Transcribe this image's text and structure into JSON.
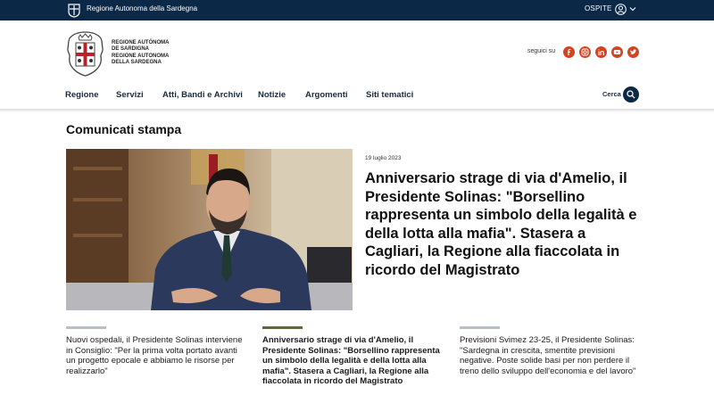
{
  "topbar": {
    "region_link": "Regione Autonoma della Sardegna",
    "user_label": "OSPITE",
    "background": "#0b2847"
  },
  "header": {
    "logo_lines": [
      "REGIONE AUTÒNOMA",
      "DE SARDIGNA",
      "REGIONE AUTONOMA",
      "DELLA SARDEGNA"
    ],
    "follow_label": "seguici su",
    "social_icons": [
      "facebook-icon",
      "instagram-icon",
      "linkedin-icon",
      "youtube-icon",
      "twitter-icon"
    ],
    "accent": "#d1451f"
  },
  "nav": {
    "items": [
      "Regione",
      "Servizi",
      "Atti, Bandi e Archivi",
      "Notizie",
      "Argomenti",
      "Siti tematici"
    ],
    "search_label": "Cerca"
  },
  "main": {
    "section_title": "Comunicati stampa",
    "featured": {
      "date": "19 luglio 2023",
      "title": "Anniversario strage di via d'Amelio, il Presidente Solinas: \"Borsellino rappresenta un simbolo della legalità e della lotta alla mafia\". Stasera a Cagliari, la Regione alla fiaccolata in ricordo del Magistrato"
    },
    "cards": [
      {
        "text": "Nuovi ospedali, il Presidente Solinas interviene in Consiglio: \"Per la prima volta portato avanti un progetto epocale e abbiamo le risorse per realizzarlo\""
      },
      {
        "text": "Anniversario strage di via d'Amelio, il Presidente Solinas: \"Borsellino rappresenta un simbolo della legalità e della lotta alla mafia\". Stasera a Cagliari, la Regione alla fiaccolata in ricordo del Magistrato"
      },
      {
        "text": "Previsioni Svimez 23-25, il Presidente Solinas: \"Sardegna in crescita, smentite previsioni negative. Poste solide basi per non perdere il treno dello sviluppo dell'economia e del lavoro\""
      }
    ]
  }
}
